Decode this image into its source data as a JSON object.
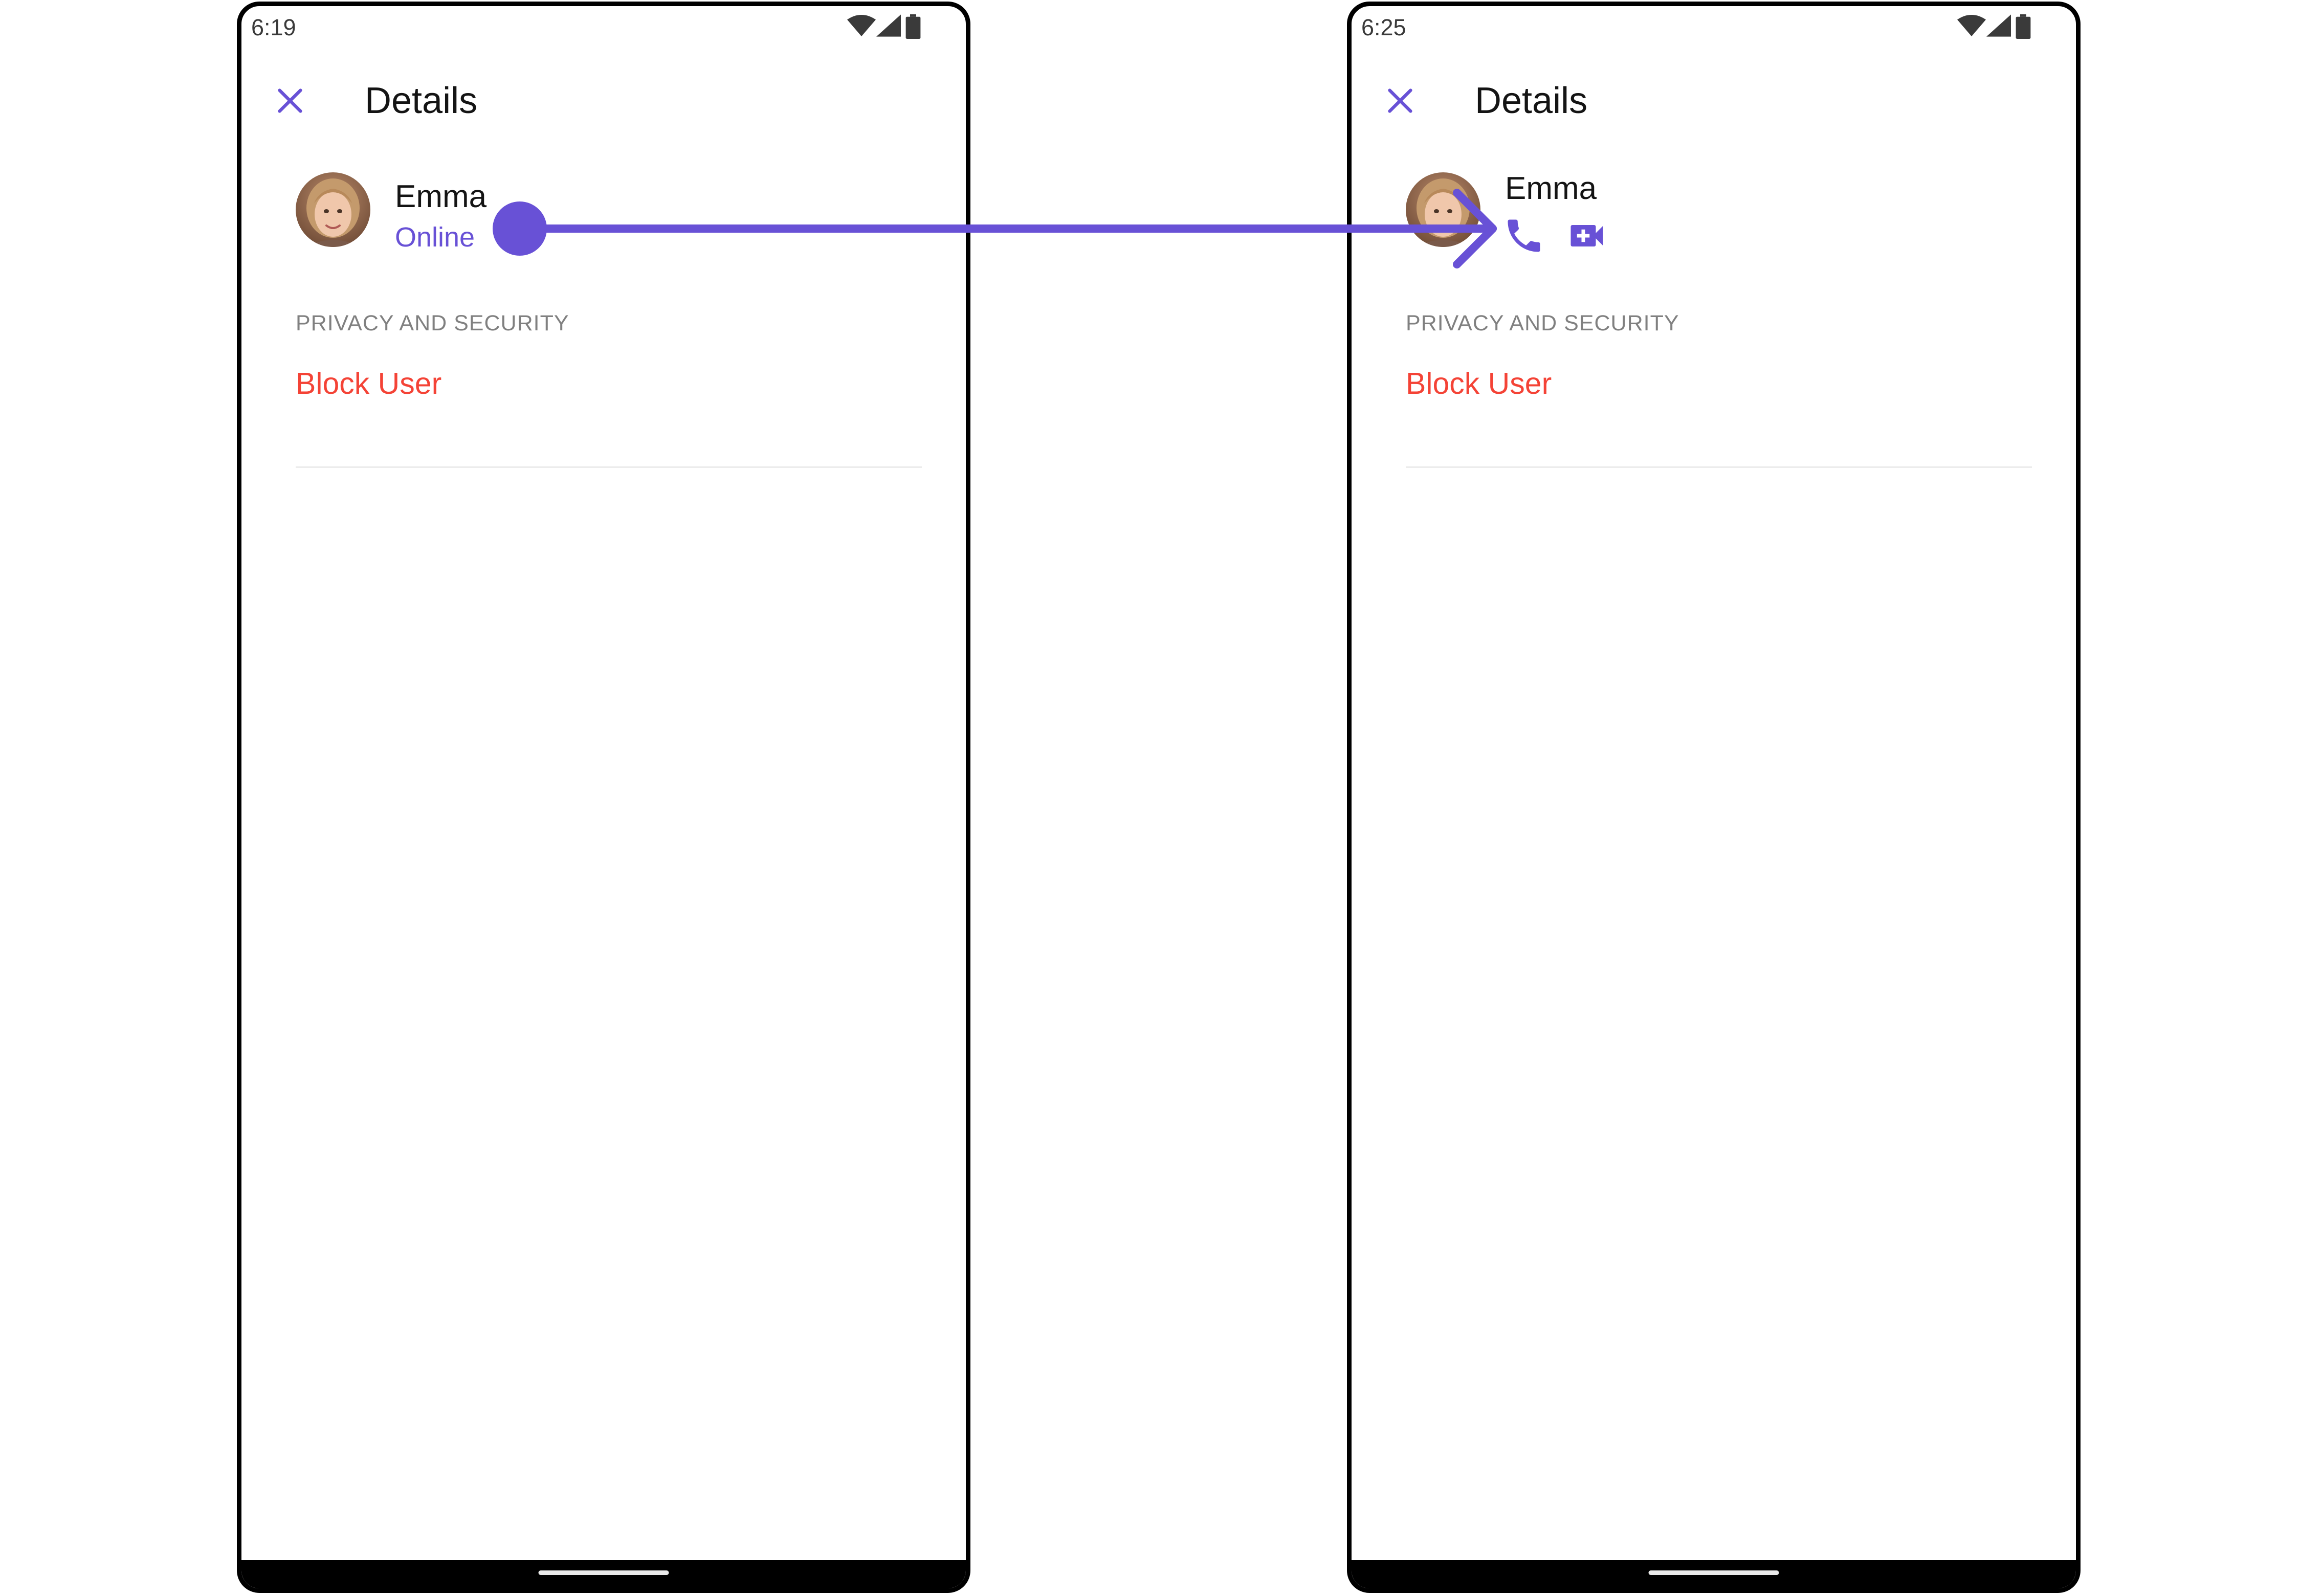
{
  "left_screen": {
    "status_time": "6:19",
    "title": "Details",
    "user": {
      "name": "Emma",
      "status": "Online"
    },
    "section_header": "PRIVACY AND SECURITY",
    "block_label": "Block User"
  },
  "right_screen": {
    "status_time": "6:25",
    "title": "Details",
    "user": {
      "name": "Emma"
    },
    "actions": [
      "phone-call-icon",
      "video-call-icon"
    ],
    "section_header": "PRIVACY AND SECURITY",
    "block_label": "Block User"
  },
  "colors": {
    "accent": "#6851d6",
    "danger": "#f44336",
    "section_header": "#808080",
    "frame": "#000000"
  },
  "icons": [
    "wifi-icon",
    "signal-icon",
    "battery-icon",
    "close-icon",
    "avatar",
    "phone-call-icon",
    "video-call-icon",
    "transition-arrow"
  ]
}
